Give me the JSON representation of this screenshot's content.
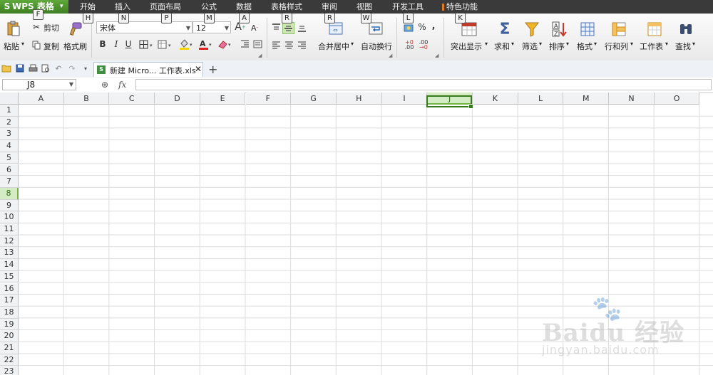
{
  "app": {
    "logo": "S",
    "title": "WPS 表格",
    "arrow": "▾"
  },
  "menu_tabs": [
    {
      "label": "开始",
      "key": "H"
    },
    {
      "label": "插入",
      "key": "N"
    },
    {
      "label": "页面布局",
      "key": "P"
    },
    {
      "label": "公式",
      "key": "M"
    },
    {
      "label": "数据",
      "key": "A"
    },
    {
      "label": "表格样式",
      "key": "R"
    },
    {
      "label": "审阅",
      "key": "R"
    },
    {
      "label": "视图",
      "key": "W"
    },
    {
      "label": "开发工具",
      "key": "L"
    },
    {
      "label": "特色功能",
      "key": "K"
    }
  ],
  "app_key": "F",
  "ribbon": {
    "paste": "粘贴",
    "cut": "剪切",
    "copy": "复制",
    "format_painter": "格式刷",
    "font_name": "宋体",
    "font_size": "12",
    "bold": "B",
    "italic": "I",
    "underline": "U",
    "merge_center": "合并居中",
    "wrap_text": "自动换行",
    "percent": "%",
    "comma": ",",
    "inc_decimal": ".00",
    "dec_decimal": ".00",
    "conditional": "突出显示",
    "sum": "求和",
    "filter": "筛选",
    "sort": "排序",
    "format": "格式",
    "rows_cols": "行和列",
    "worksheet": "工作表",
    "find": "查找"
  },
  "doc_tab": {
    "name": "新建 Micro... 工作表.xls",
    "close": "✕",
    "add": "+"
  },
  "formula_bar": {
    "cell_ref": "J8",
    "fx": "fx",
    "zoom": "⊕"
  },
  "columns": [
    "A",
    "B",
    "C",
    "D",
    "E",
    "F",
    "G",
    "H",
    "I",
    "J",
    "K",
    "L",
    "M",
    "N",
    "O"
  ],
  "rows": [
    "1",
    "2",
    "3",
    "4",
    "5",
    "6",
    "7",
    "8",
    "9",
    "10",
    "11",
    "12",
    "13",
    "14",
    "15",
    "16",
    "17",
    "18",
    "19",
    "20",
    "21",
    "22",
    "23"
  ],
  "selected_column": "J",
  "selected_row": "8",
  "watermark": {
    "line1": "Baidu 经验",
    "line2": "jingyan.baidu.com"
  },
  "colors": {
    "accent": "#3f7f22",
    "selected_header": "#d3ecc4",
    "titlebar": "#3a3a3a"
  }
}
